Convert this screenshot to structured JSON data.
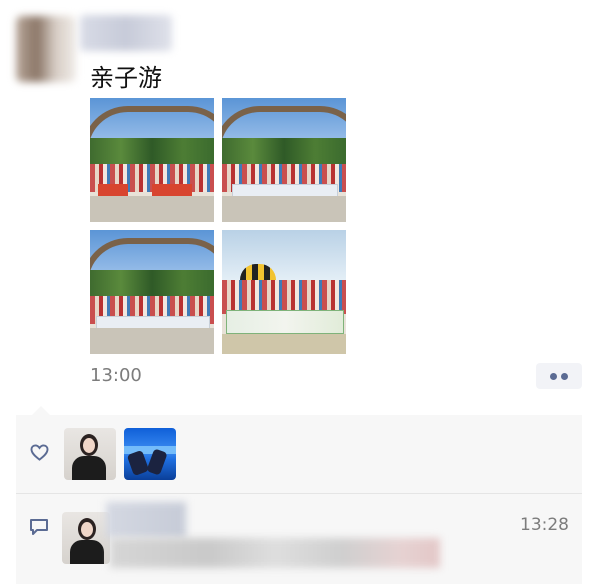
{
  "post": {
    "text": "亲子游",
    "time": "13:00"
  },
  "actions": {
    "more_icon": "more-dots-icon"
  },
  "likes": {
    "icon": "heart-icon"
  },
  "comments": {
    "icon": "comment-bubble-icon",
    "items": [
      {
        "time": "13:28"
      }
    ]
  },
  "colors": {
    "accent": "#5b6b93",
    "panel_bg": "#f7f7f7",
    "timestamp": "#7c7c7c"
  }
}
